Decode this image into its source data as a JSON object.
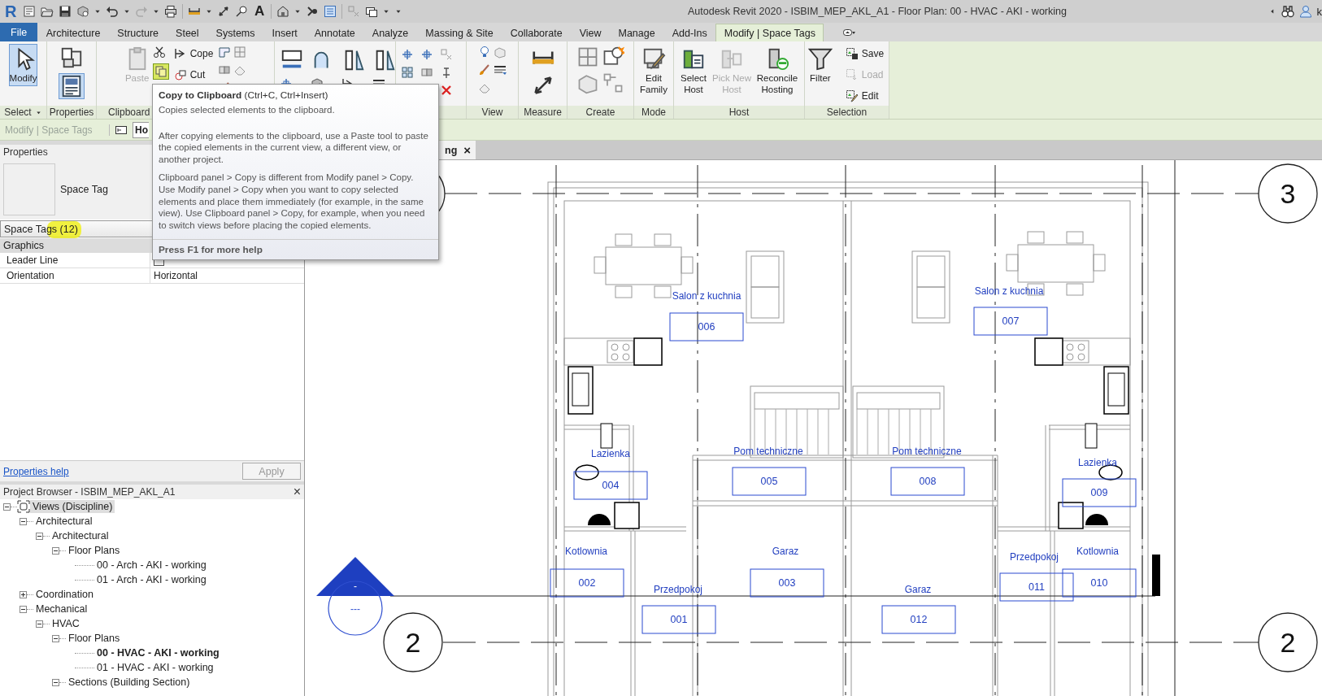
{
  "title_bar": {
    "logo": "R",
    "text_tool": "A",
    "title": "Autodesk Revit 2020 - ISBIM_MEP_AKL_A1 - Floor Plan: 00 - HVAC - AKI - working",
    "user": "k"
  },
  "ribbon_tabs": [
    {
      "label": "File",
      "kind": "file",
      "selected": false
    },
    {
      "label": "Architecture",
      "kind": "tab",
      "selected": false
    },
    {
      "label": "Structure",
      "kind": "tab",
      "selected": false
    },
    {
      "label": "Steel",
      "kind": "tab",
      "selected": false
    },
    {
      "label": "Systems",
      "kind": "tab",
      "selected": false
    },
    {
      "label": "Insert",
      "kind": "tab",
      "selected": false
    },
    {
      "label": "Annotate",
      "kind": "tab",
      "selected": false
    },
    {
      "label": "Analyze",
      "kind": "tab",
      "selected": false
    },
    {
      "label": "Massing & Site",
      "kind": "tab",
      "selected": false
    },
    {
      "label": "Collaborate",
      "kind": "tab",
      "selected": false
    },
    {
      "label": "View",
      "kind": "tab",
      "selected": false
    },
    {
      "label": "Manage",
      "kind": "tab",
      "selected": false
    },
    {
      "label": "Add-Ins",
      "kind": "tab",
      "selected": false
    },
    {
      "label": "Modify | Space Tags",
      "kind": "tab",
      "selected": true
    }
  ],
  "ribbon_panels": [
    {
      "label": "Select",
      "tools": [
        {
          "label": "Modify",
          "kind": "large",
          "selected": true,
          "disabled": false
        }
      ]
    },
    {
      "label": "Properties"
    },
    {
      "label": "Clipboard",
      "tools": [
        {
          "label": "Paste",
          "kind": "large",
          "selected": false,
          "disabled": true
        },
        {
          "label": "Cope",
          "kind": "small",
          "selected": false,
          "disabled": false
        },
        {
          "label": "Cut",
          "kind": "small",
          "selected": false,
          "disabled": false
        }
      ]
    },
    {
      "label": "View"
    },
    {
      "label": "Measure"
    },
    {
      "label": "Create"
    },
    {
      "label": "Mode",
      "tools": [
        {
          "label": "Edit Family",
          "kind": "large",
          "selected": false,
          "disabled": false
        }
      ]
    },
    {
      "label": "Host",
      "tools": [
        {
          "label": "Select Host",
          "kind": "large",
          "selected": false,
          "disabled": false
        },
        {
          "label": "Pick New Host",
          "kind": "large",
          "selected": false,
          "disabled": true
        },
        {
          "label": "Reconcile Hosting",
          "kind": "large",
          "selected": false,
          "disabled": false
        }
      ]
    },
    {
      "label": "Selection",
      "tools": [
        {
          "label": "Filter",
          "kind": "large",
          "selected": false,
          "disabled": false
        },
        {
          "label": "Save",
          "kind": "small",
          "selected": false,
          "disabled": false
        },
        {
          "label": "Load",
          "kind": "small",
          "selected": false,
          "disabled": true
        },
        {
          "label": "Edit",
          "kind": "small",
          "selected": false,
          "disabled": false
        }
      ]
    }
  ],
  "options_bar": {
    "context": "Modify | Space Tags",
    "field": "Ho"
  },
  "properties": {
    "title": "Properties",
    "type_name": "Space Tag",
    "selector": "Space Tags (12)",
    "groups": [
      {
        "name": "Graphics",
        "rows": [
          {
            "name": "Leader Line",
            "checked": false
          },
          {
            "name": "Orientation",
            "value": "Horizontal"
          }
        ]
      }
    ],
    "help_link": "Properties help",
    "apply": {
      "label": "Apply",
      "disabled": true
    }
  },
  "project_browser": {
    "title": "Project Browser - ISBIM_MEP_AKL_A1",
    "close": "×",
    "tree": [
      {
        "label": "Views (Discipline)",
        "expanded": true,
        "selected": true,
        "current": false,
        "children": [
          {
            "label": "Architectural",
            "expanded": true,
            "selected": false,
            "current": false,
            "children": [
              {
                "label": "Architectural",
                "expanded": true,
                "selected": false,
                "current": false,
                "children": [
                  {
                    "label": "Floor Plans",
                    "expanded": true,
                    "selected": false,
                    "current": false,
                    "children": [
                      {
                        "label": "00 - Arch - AKI - working",
                        "selected": false,
                        "current": false
                      },
                      {
                        "label": "01 - Arch - AKI - working",
                        "selected": false,
                        "current": false
                      }
                    ]
                  }
                ]
              }
            ]
          },
          {
            "label": "Coordination",
            "expanded": false,
            "selected": false,
            "current": false
          },
          {
            "label": "Mechanical",
            "expanded": true,
            "selected": false,
            "current": false,
            "children": [
              {
                "label": "HVAC",
                "expanded": true,
                "selected": false,
                "current": false,
                "children": [
                  {
                    "label": "Floor Plans",
                    "expanded": true,
                    "selected": false,
                    "current": false,
                    "children": [
                      {
                        "label": "00 - HVAC - AKI - working",
                        "selected": false,
                        "current": true
                      },
                      {
                        "label": "01 - HVAC - AKI - working",
                        "selected": false,
                        "current": false
                      }
                    ]
                  },
                  {
                    "label": "Sections (Building Section)",
                    "expanded": true,
                    "selected": false,
                    "current": false
                  }
                ]
              }
            ]
          }
        ]
      }
    ]
  },
  "view_tabs": [
    {
      "label": "ng",
      "close": "×"
    }
  ],
  "plan": {
    "grid_bubbles": [
      {
        "label": "3"
      },
      {
        "label": "2"
      },
      {
        "label": "2"
      }
    ],
    "section_marker": {
      "top": "-",
      "bottom": "---"
    },
    "rooms": [
      {
        "name": "Salon z kuchnia",
        "number": "006"
      },
      {
        "name": "Salon z kuchnia",
        "number": "007"
      },
      {
        "name": "Lazienka",
        "number": "004"
      },
      {
        "name": "Pom techniczne",
        "number": "005"
      },
      {
        "name": "Pom techniczne",
        "number": "008"
      },
      {
        "name": "Lazienka",
        "number": "009"
      },
      {
        "name": "Kotlownia",
        "number": "002"
      },
      {
        "name": "Garaz",
        "number": "003"
      },
      {
        "name": "Przedpokoj",
        "number": "001"
      },
      {
        "name": "Garaz",
        "number": "012"
      },
      {
        "name": "Przedpokoj",
        "number": "011"
      },
      {
        "name": "Kotlownia",
        "number": "010"
      }
    ]
  },
  "tooltip": {
    "title": "**Copy to Clipboard** (Ctrl+C, Ctrl+Insert)",
    "summary": "Copies selected elements to the clipboard.",
    "paragraphs": [
      "After copying elements to the clipboard, use a Paste tool to paste the copied elements in the current view, a different view, or another project.",
      "Clipboard panel > Copy is different from Modify panel > Copy. Use Modify panel > Copy when you want to copy selected elements and place them immediately (for example, in the same view). Use Clipboard panel > Copy, for example, when you need to switch views before placing the copied elements."
    ],
    "footer": "Press F1 for more help"
  }
}
